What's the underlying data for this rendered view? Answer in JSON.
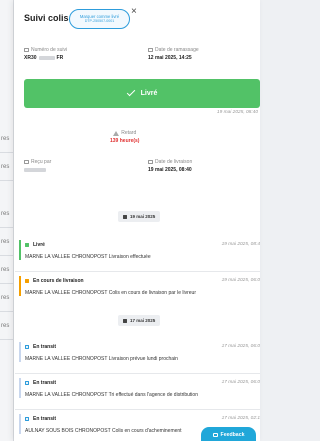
{
  "background": {
    "row_fragments": [
      "res",
      "res",
      "res",
      "res",
      "res",
      "res",
      "res"
    ]
  },
  "panel": {
    "title": "Suivi colis",
    "mark_button": {
      "line1": "Marquer comme livré",
      "line2": "DTP-250507-0001"
    },
    "close_label": "×"
  },
  "info": {
    "tracking_label": "Numéro de suivi",
    "tracking_prefix": "XR30",
    "tracking_suffix": "FR",
    "pickup_label": "Date de ramassage",
    "pickup_value": "12 mai 2025, 14:25"
  },
  "status": {
    "label": "Livré",
    "timestamp": "19 mai 2025, 08:40",
    "color": "#52c267"
  },
  "delay": {
    "label": "Retard",
    "value": "139 heure(s)",
    "color": "#e03131"
  },
  "receipt": {
    "received_by_label": "Reçu par",
    "delivery_label": "Date de livraison",
    "delivery_value": "19 mai 2025, 08:40"
  },
  "timeline": {
    "groups": [
      {
        "date": "19 mai 2025",
        "events": [
          {
            "title": "Livré",
            "icon": "check-icon",
            "timestamp": "19 mai 2025, 08:4",
            "description": "MARNE LA VALLEE CHRONOPOST Livraison effectuée"
          },
          {
            "title": "En cours de livraison",
            "icon": "truck-icon",
            "timestamp": "19 mai 2025, 06:0",
            "description": "MARNE LA VALLEE CHRONOPOST Colis en cours de livraison par le livreur"
          }
        ]
      },
      {
        "date": "17 mai 2025",
        "events": [
          {
            "title": "En transit",
            "icon": "box-icon",
            "timestamp": "17 mai 2025, 06:0",
            "description": "MARNE LA VALLEE CHRONOPOST Livraison prévue lundi prochain"
          },
          {
            "title": "En transit",
            "icon": "box-icon",
            "timestamp": "17 mai 2025, 06:0",
            "description": "MARNE LA VALLEE CHRONOPOST Tri effectué dans l'agence de distribution"
          },
          {
            "title": "En transit",
            "icon": "box-icon",
            "timestamp": "17 mai 2025, 02:1",
            "description": "AULNAY SOUS BOIS CHRONOPOST Colis en cours d'acheminement"
          }
        ]
      }
    ]
  },
  "feedback": {
    "label": "Feedback"
  }
}
